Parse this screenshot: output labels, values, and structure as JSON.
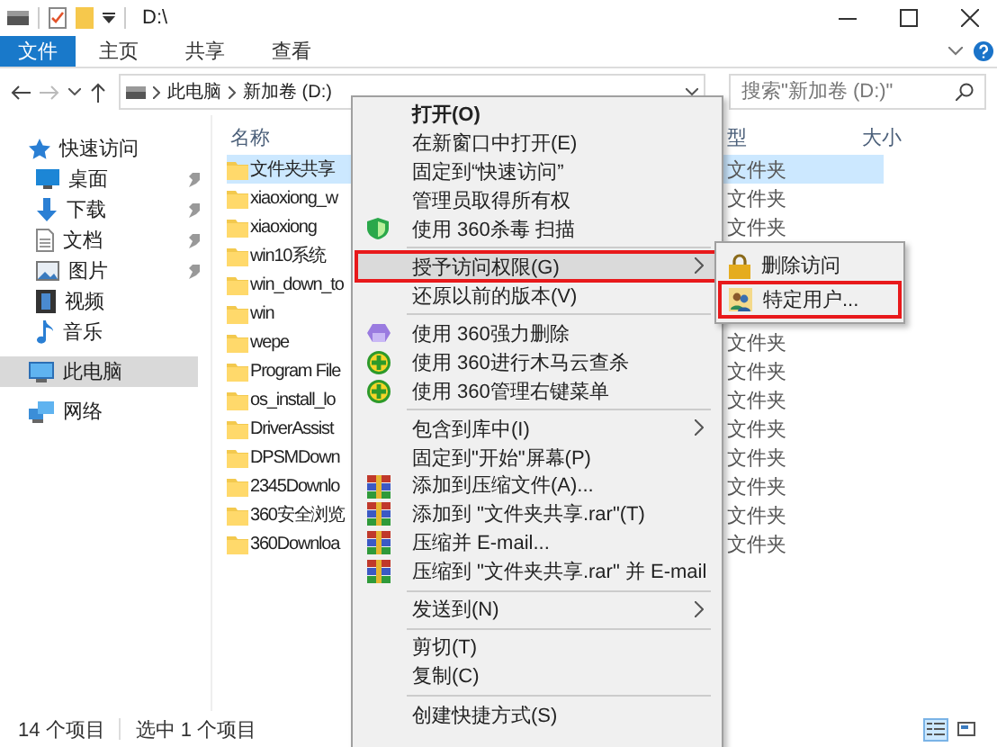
{
  "window": {
    "title": "D:\\"
  },
  "ribbon_tabs": [
    {
      "label": "文件",
      "kind": "file"
    },
    {
      "label": "主页",
      "kind": "tab"
    },
    {
      "label": "共享",
      "kind": "tab"
    },
    {
      "label": "查看",
      "kind": "tab"
    }
  ],
  "address": {
    "crumbs": [
      "此电脑",
      "新加卷 (D:)"
    ]
  },
  "search": {
    "placeholder": "搜索\"新加卷 (D:)\""
  },
  "nav": [
    {
      "label": "快速访问",
      "selected": false,
      "children": [
        {
          "label": "桌面",
          "pinned": true,
          "selected": false
        },
        {
          "label": "下载",
          "pinned": true,
          "selected": false
        },
        {
          "label": "文档",
          "pinned": true,
          "selected": false
        },
        {
          "label": "图片",
          "pinned": true,
          "selected": false
        },
        {
          "label": "视频",
          "pinned": false,
          "selected": false
        },
        {
          "label": "音乐",
          "pinned": false,
          "selected": false
        }
      ]
    },
    {
      "label": "此电脑",
      "selected": true
    },
    {
      "label": "网络",
      "selected": false
    }
  ],
  "columns": [
    {
      "label": "名称",
      "kind": "name"
    },
    {
      "label": "型",
      "kind": "type"
    },
    {
      "label": "大小",
      "kind": "size"
    }
  ],
  "files": [
    {
      "name": "文件夹共享",
      "type": "文件夹",
      "selected": true
    },
    {
      "name": "xiaoxiong_w",
      "type": "文件夹",
      "selected": false
    },
    {
      "name": "xiaoxiong",
      "type": "文件夹",
      "selected": false
    },
    {
      "name": "win10系统",
      "selected": false
    },
    {
      "name": "win_down_to",
      "selected": false
    },
    {
      "name": "win",
      "selected": false
    },
    {
      "name": "wepe",
      "type": "文件夹",
      "selected": false
    },
    {
      "name": "Program File",
      "type": "文件夹",
      "selected": false
    },
    {
      "name": "os_install_lo",
      "type": "文件夹",
      "selected": false
    },
    {
      "name": "DriverAssist",
      "type": "文件夹",
      "selected": false
    },
    {
      "name": "DPSMDown",
      "type": "文件夹",
      "selected": false
    },
    {
      "name": "2345Downlo",
      "type": "文件夹",
      "selected": false
    },
    {
      "name": "360安全浏览",
      "type": "文件夹",
      "selected": false
    },
    {
      "name": "360Downloa",
      "type": "文件夹",
      "selected": false
    }
  ],
  "context_menu": [
    {
      "kind": "item",
      "label": "打开(O)",
      "bold": true
    },
    {
      "kind": "item",
      "label": "在新窗口中打开(E)"
    },
    {
      "kind": "item",
      "label": "固定到“快速访问”"
    },
    {
      "kind": "item",
      "label": "管理员取得所有权"
    },
    {
      "kind": "item",
      "label": "使用 360杀毒 扫描"
    },
    {
      "kind": "separator"
    },
    {
      "kind": "item",
      "label": "授予访问权限(G)",
      "submenu": true,
      "selected": true,
      "outlined": true
    },
    {
      "kind": "item",
      "label": "还原以前的版本(V)"
    },
    {
      "kind": "separator"
    },
    {
      "kind": "item",
      "label": "使用 360强力删除"
    },
    {
      "kind": "item",
      "label": "使用 360进行木马云查杀"
    },
    {
      "kind": "item",
      "label": "使用 360管理右键菜单"
    },
    {
      "kind": "separator"
    },
    {
      "kind": "item",
      "label": "包含到库中(I)",
      "submenu": true
    },
    {
      "kind": "item",
      "label": "固定到\"开始\"屏幕(P)"
    },
    {
      "kind": "item",
      "label": "添加到压缩文件(A)..."
    },
    {
      "kind": "item",
      "label": "添加到 \"文件夹共享.rar\"(T)"
    },
    {
      "kind": "item",
      "label": "压缩并 E-mail..."
    },
    {
      "kind": "item",
      "label": "压缩到 \"文件夹共享.rar\" 并 E-mail"
    },
    {
      "kind": "separator"
    },
    {
      "kind": "item",
      "label": "发送到(N)",
      "submenu": true
    },
    {
      "kind": "separator"
    },
    {
      "kind": "item",
      "label": "剪切(T)"
    },
    {
      "kind": "item",
      "label": "复制(C)"
    },
    {
      "kind": "separator"
    },
    {
      "kind": "item",
      "label": "创建快捷方式(S)"
    }
  ],
  "submenu": [
    {
      "label": "删除访问",
      "outlined": false
    },
    {
      "label": "特定用户...",
      "outlined": true
    }
  ],
  "status_bar": {
    "count": "14 个项目",
    "selection": "选中 1 个项目",
    "views": [
      {
        "kind": "details",
        "selected": true
      },
      {
        "kind": "tiles",
        "selected": false
      }
    ]
  }
}
